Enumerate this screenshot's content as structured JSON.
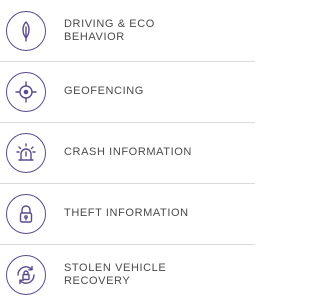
{
  "colors": {
    "icon_stroke": "#5b4a8e",
    "text": "#4b4b4b",
    "divider": "#d9d9de",
    "background": "#ffffff"
  },
  "features": [
    {
      "label": "DRIVING & ECO BEHAVIOR",
      "icon": "leaf-icon"
    },
    {
      "label": "GEOFENCING",
      "icon": "target-icon"
    },
    {
      "label": "CRASH INFORMATION",
      "icon": "siren-icon"
    },
    {
      "label": "THEFT INFORMATION",
      "icon": "lock-icon"
    },
    {
      "label": "STOLEN VEHICLE RECOVERY",
      "icon": "lock-recovery-icon"
    }
  ]
}
